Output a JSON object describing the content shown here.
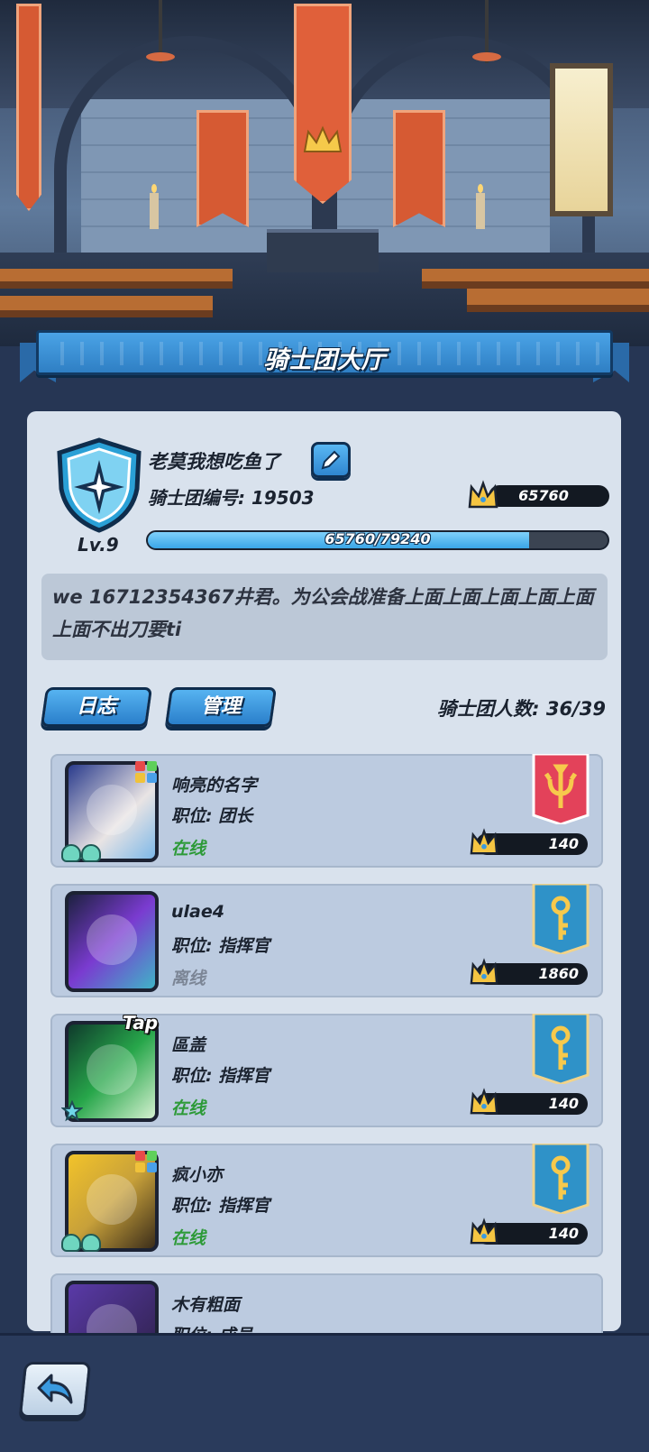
{
  "screen": {
    "title": "骑士团大厅"
  },
  "guild": {
    "name": "老莫我想吃鱼了",
    "id_label": "骑士团编号: 19503",
    "points": "65760",
    "level": "Lv.9",
    "exp_text": "65760/79240",
    "exp_fraction": 0.83,
    "notice": "we 16712354367井君。为公会战准备上面上面上面上面上面上面不出刀要ti"
  },
  "tabs": {
    "log_label": "日志",
    "manage_label": "管理"
  },
  "member_count": "骑士团人数: 36/39",
  "members": [
    {
      "name": "响亮的名字",
      "role": "职位: 团长",
      "status": "在线",
      "points": "140",
      "rank_icon": "trident-banner-icon",
      "rank_color": "#e3425a"
    },
    {
      "name": "ulae4",
      "role": "职位: 指挥官",
      "status": "离线",
      "points": "1860",
      "rank_icon": "key-banner-icon",
      "rank_color": "#2f92c8"
    },
    {
      "name": "區盖",
      "role": "职位: 指挥官",
      "status": "在线",
      "points": "140",
      "rank_icon": "key-banner-icon",
      "rank_color": "#2f92c8",
      "badge": "Tap"
    },
    {
      "name": "疯小亦",
      "role": "职位: 指挥官",
      "status": "在线",
      "points": "140",
      "rank_icon": "key-banner-icon",
      "rank_color": "#2f92c8"
    },
    {
      "name": "木有粗面",
      "role": "职位: 成员"
    }
  ],
  "colors": {
    "online": "#2d9a38",
    "offline": "#7c8696",
    "accent": "#3a9ae0",
    "panel": "#d9e2ed"
  }
}
